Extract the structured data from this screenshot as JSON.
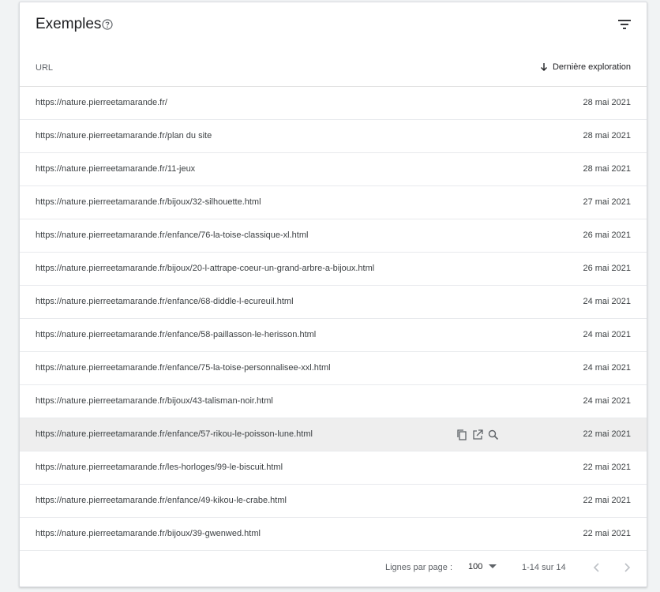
{
  "panel": {
    "title": "Exemples"
  },
  "table": {
    "columns": {
      "url": "URL",
      "date": "Dernière exploration"
    },
    "rows": [
      {
        "url": "https://nature.pierreetamarande.fr/",
        "date": "28 mai 2021"
      },
      {
        "url": "https://nature.pierreetamarande.fr/plan du site",
        "date": "28 mai 2021"
      },
      {
        "url": "https://nature.pierreetamarande.fr/11-jeux",
        "date": "28 mai 2021"
      },
      {
        "url": "https://nature.pierreetamarande.fr/bijoux/32-silhouette.html",
        "date": "27 mai 2021"
      },
      {
        "url": "https://nature.pierreetamarande.fr/enfance/76-la-toise-classique-xl.html",
        "date": "26 mai 2021"
      },
      {
        "url": "https://nature.pierreetamarande.fr/bijoux/20-l-attrape-coeur-un-grand-arbre-a-bijoux.html",
        "date": "26 mai 2021"
      },
      {
        "url": "https://nature.pierreetamarande.fr/enfance/68-diddle-l-ecureuil.html",
        "date": "24 mai 2021"
      },
      {
        "url": "https://nature.pierreetamarande.fr/enfance/58-paillasson-le-herisson.html",
        "date": "24 mai 2021"
      },
      {
        "url": "https://nature.pierreetamarande.fr/enfance/75-la-toise-personnalisee-xxl.html",
        "date": "24 mai 2021"
      },
      {
        "url": "https://nature.pierreetamarande.fr/bijoux/43-talisman-noir.html",
        "date": "24 mai 2021"
      },
      {
        "url": "https://nature.pierreetamarande.fr/enfance/57-rikou-le-poisson-lune.html",
        "date": "22 mai 2021"
      },
      {
        "url": "https://nature.pierreetamarande.fr/les-horloges/99-le-biscuit.html",
        "date": "22 mai 2021"
      },
      {
        "url": "https://nature.pierreetamarande.fr/enfance/49-kikou-le-crabe.html",
        "date": "22 mai 2021"
      },
      {
        "url": "https://nature.pierreetamarande.fr/bijoux/39-gwenwed.html",
        "date": "22 mai 2021"
      }
    ]
  },
  "pagination": {
    "rows_per_page_label": "Lignes par page :",
    "rows_per_page_value": "100",
    "range": "1-14 sur 14"
  },
  "icons": {
    "help": "help-circle-icon",
    "filter": "filter-icon",
    "sort": "arrow-down-icon",
    "copy": "copy-icon",
    "open": "open-in-new-icon",
    "inspect": "search-icon",
    "dropdown": "caret-down-icon",
    "prev": "chevron-left-icon",
    "next": "chevron-right-icon"
  },
  "colors": {
    "text": "#202124",
    "muted": "#5f6368",
    "hover_row": "#eeeeee"
  }
}
